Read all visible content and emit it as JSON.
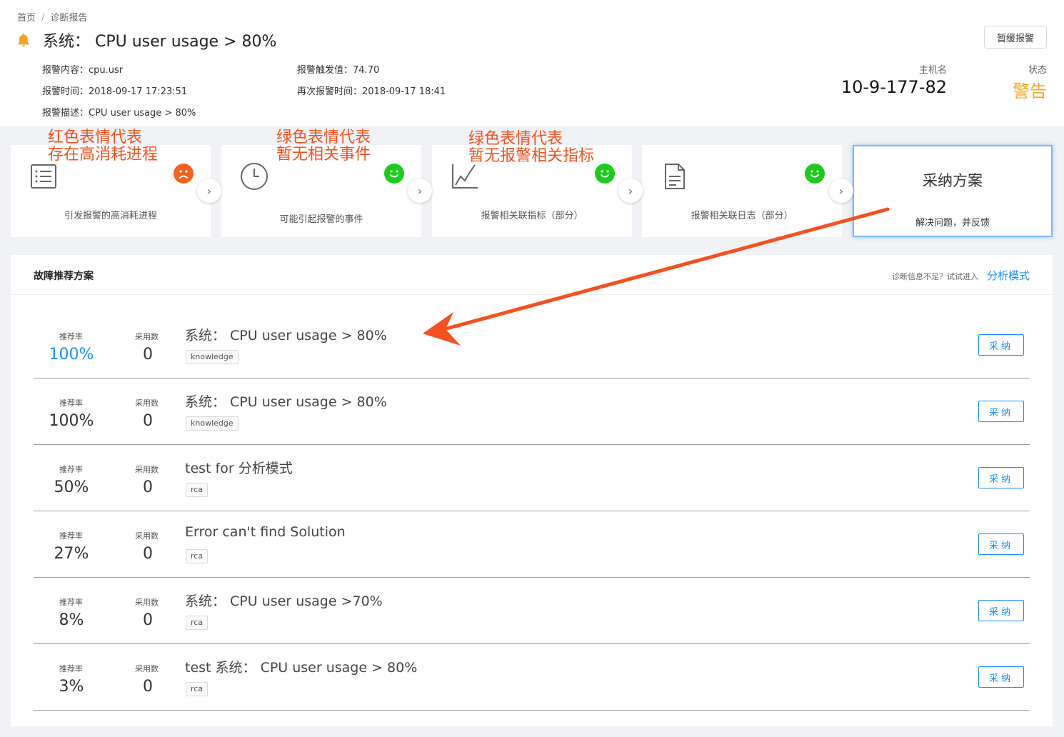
{
  "breadcrumb": {
    "home": "首页",
    "sep": "/",
    "current": "诊断报告"
  },
  "title": "系统： CPU user usage > 80%",
  "snooze_label": "暂缓报警",
  "meta": {
    "content_label": "报警内容：",
    "content_value": "cpu.usr",
    "trigger_label": "报警触发值：",
    "trigger_value": "74.70",
    "time_label": "报警时间：",
    "time_value": "2018-09-17 17:23:51",
    "retime_label": "再次报警时间：",
    "retime_value": "2018-09-17 18:41",
    "desc_label": "报警描述：",
    "desc_value": "CPU user usage > 80%"
  },
  "host": {
    "label": "主机名",
    "value": "10-9-177-82"
  },
  "state": {
    "label": "状态",
    "value": "警告",
    "color": "#f5a623"
  },
  "cards": [
    {
      "label": "引发报警的高消耗进程",
      "icon": "list-icon",
      "status": "sad",
      "color": "#f5621e"
    },
    {
      "label": "可能引起报警的事件",
      "icon": "clock-icon",
      "status": "happy",
      "color": "#1ccc1c"
    },
    {
      "label": "报警相关联指标（部分）",
      "icon": "chart-icon",
      "status": "happy",
      "color": "#1ccc1c"
    },
    {
      "label": "报警相关联日志（部分）",
      "icon": "document-icon",
      "status": "happy",
      "color": "#1ccc1c"
    }
  ],
  "adopt_card": {
    "title": "采纳方案",
    "subtitle": "解决问题，并反馈"
  },
  "annotations": [
    {
      "line1": "红色表情代表",
      "line2": "存在高消耗进程"
    },
    {
      "line1": "绿色表情代表",
      "line2": "暂无相关事件"
    },
    {
      "line1": "绿色表情代表",
      "line2": "暂无报警相关指标"
    }
  ],
  "panel": {
    "title": "故障推荐方案",
    "hint": "诊断信息不足？试试进入",
    "link": "分析模式",
    "rate_label": "推荐率",
    "use_label": "采用数",
    "adopt_label": "采纳"
  },
  "solutions": [
    {
      "rate": "100%",
      "uses": "0",
      "title": "系统： CPU user usage > 80%",
      "tag": "knowledge",
      "highlight": true
    },
    {
      "rate": "100%",
      "uses": "0",
      "title": "系统： CPU user usage > 80%",
      "tag": "knowledge",
      "highlight": false
    },
    {
      "rate": "50%",
      "uses": "0",
      "title": "test for 分析模式",
      "tag": "rca",
      "highlight": false
    },
    {
      "rate": "27%",
      "uses": "0",
      "title": "Error can't find Solution",
      "tag": "rca",
      "highlight": false
    },
    {
      "rate": "8%",
      "uses": "0",
      "title": "系统： CPU user usage >70%",
      "tag": "rca",
      "highlight": false
    },
    {
      "rate": "3%",
      "uses": "0",
      "title": "test 系统： CPU user usage > 80%",
      "tag": "rca",
      "highlight": false
    }
  ],
  "colors": {
    "accent": "#1890ff",
    "warning": "#f5a623",
    "annotation": "#f4511e",
    "happy": "#1ccc1c",
    "sad": "#f5621e"
  }
}
